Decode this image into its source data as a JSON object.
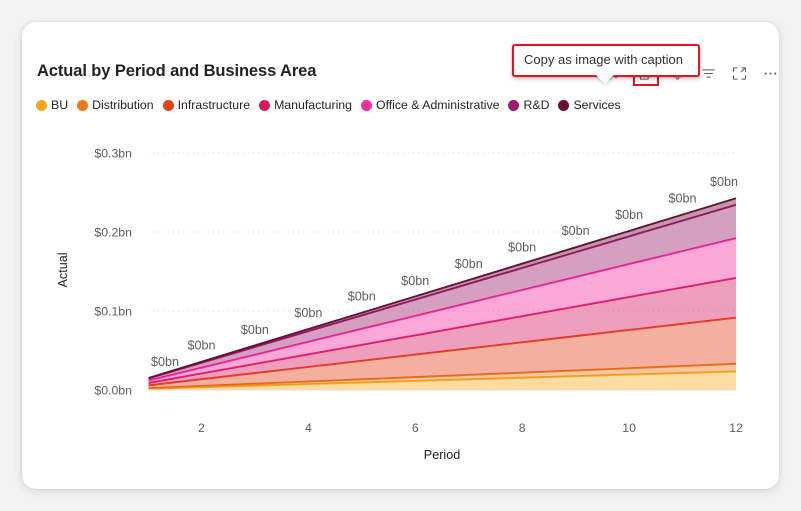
{
  "card": {
    "title": "Actual by Period and Business Area"
  },
  "tooltip": {
    "text": "Copy as image with caption",
    "highlight_color": "#e81123"
  },
  "toolbar": {
    "buttons": [
      {
        "name": "pin-icon",
        "label": "Pin to dashboard",
        "highlighted": false
      },
      {
        "name": "copy-icon",
        "label": "Copy as image with caption",
        "highlighted": true
      },
      {
        "name": "bell-icon",
        "label": "Alerts",
        "highlighted": false
      },
      {
        "name": "filter-icon",
        "label": "Filters",
        "highlighted": false
      },
      {
        "name": "focus-mode-icon",
        "label": "Focus mode",
        "highlighted": false
      },
      {
        "name": "more-options-icon",
        "label": "More options",
        "highlighted": false
      }
    ]
  },
  "legend": [
    {
      "label": "BU",
      "color": "#F2A91E"
    },
    {
      "label": "Distribution",
      "color": "#E8781A"
    },
    {
      "label": "Infrastructure",
      "color": "#E8411A"
    },
    {
      "label": "Manufacturing",
      "color": "#D81B60"
    },
    {
      "label": "Office & Administrative",
      "color": "#F62DA0"
    },
    {
      "label": "R&D",
      "color": "#9B1B6E"
    },
    {
      "label": "Services",
      "color": "#6B0F34"
    }
  ],
  "chart_data": {
    "type": "area",
    "title": "Actual by Period and Business Area",
    "xlabel": "Period",
    "ylabel": "Actual",
    "stacked": true,
    "grid": true,
    "legend_position": "top",
    "x": [
      1,
      2,
      3,
      4,
      5,
      6,
      7,
      8,
      9,
      10,
      11,
      12
    ],
    "xticks": [
      2,
      4,
      6,
      8,
      10,
      12
    ],
    "xlim": [
      1,
      12
    ],
    "ylim": [
      0,
      0.32
    ],
    "yticks": [
      0.0,
      0.1,
      0.2,
      0.3
    ],
    "ytick_labels": [
      "$0.0bn",
      "$0.1bn",
      "$0.2bn",
      "$0.3bn"
    ],
    "value_unit": "bn",
    "series": [
      {
        "name": "BU",
        "color": "#F2A91E",
        "values": [
          0.0015,
          0.0035,
          0.0055,
          0.0075,
          0.0095,
          0.0115,
          0.0135,
          0.0155,
          0.0175,
          0.0195,
          0.0215,
          0.0235
        ]
      },
      {
        "name": "Distribution",
        "color": "#E8781A",
        "values": [
          0.0008,
          0.0016,
          0.0024,
          0.0032,
          0.004,
          0.0048,
          0.0056,
          0.0064,
          0.0072,
          0.008,
          0.0088,
          0.0096
        ]
      },
      {
        "name": "Infrastructure",
        "color": "#E8411A",
        "values": [
          0.0035,
          0.0085,
          0.0135,
          0.0185,
          0.0235,
          0.0285,
          0.0335,
          0.0385,
          0.0435,
          0.0485,
          0.0535,
          0.0585
        ]
      },
      {
        "name": "Manufacturing",
        "color": "#D81B60",
        "values": [
          0.003,
          0.0073,
          0.0116,
          0.0159,
          0.0202,
          0.0245,
          0.0288,
          0.0331,
          0.0374,
          0.0417,
          0.046,
          0.0503
        ]
      },
      {
        "name": "Office & Administrative",
        "color": "#F62DA0",
        "values": [
          0.003,
          0.0073,
          0.0116,
          0.0159,
          0.0202,
          0.0245,
          0.0288,
          0.0331,
          0.0374,
          0.0417,
          0.046,
          0.0503
        ]
      },
      {
        "name": "R&D",
        "color": "#9B1B6E",
        "values": [
          0.0026,
          0.0062,
          0.0098,
          0.0134,
          0.017,
          0.0206,
          0.0242,
          0.0278,
          0.0314,
          0.035,
          0.0386,
          0.0422
        ]
      },
      {
        "name": "Services",
        "color": "#6B0F34",
        "values": [
          0.0006,
          0.0013,
          0.002,
          0.0027,
          0.0034,
          0.0041,
          0.0048,
          0.0055,
          0.0062,
          0.0069,
          0.0076,
          0.0083
        ]
      }
    ],
    "totals": [
      0.015,
      0.036,
      0.056,
      0.077,
      0.098,
      0.118,
      0.139,
      0.16,
      0.181,
      0.201,
      0.222,
      0.243
    ],
    "data_labels": [
      {
        "x": 1,
        "text": "$0bn"
      },
      {
        "x": 2,
        "text": "$0bn"
      },
      {
        "x": 3,
        "text": "$0bn"
      },
      {
        "x": 4,
        "text": "$0bn"
      },
      {
        "x": 5,
        "text": "$0bn"
      },
      {
        "x": 6,
        "text": "$0bn"
      },
      {
        "x": 7,
        "text": "$0bn"
      },
      {
        "x": 8,
        "text": "$0bn"
      },
      {
        "x": 9,
        "text": "$0bn"
      },
      {
        "x": 10,
        "text": "$0bn"
      },
      {
        "x": 11,
        "text": "$0bn"
      },
      {
        "x": 12,
        "text": "$0bn"
      }
    ]
  }
}
